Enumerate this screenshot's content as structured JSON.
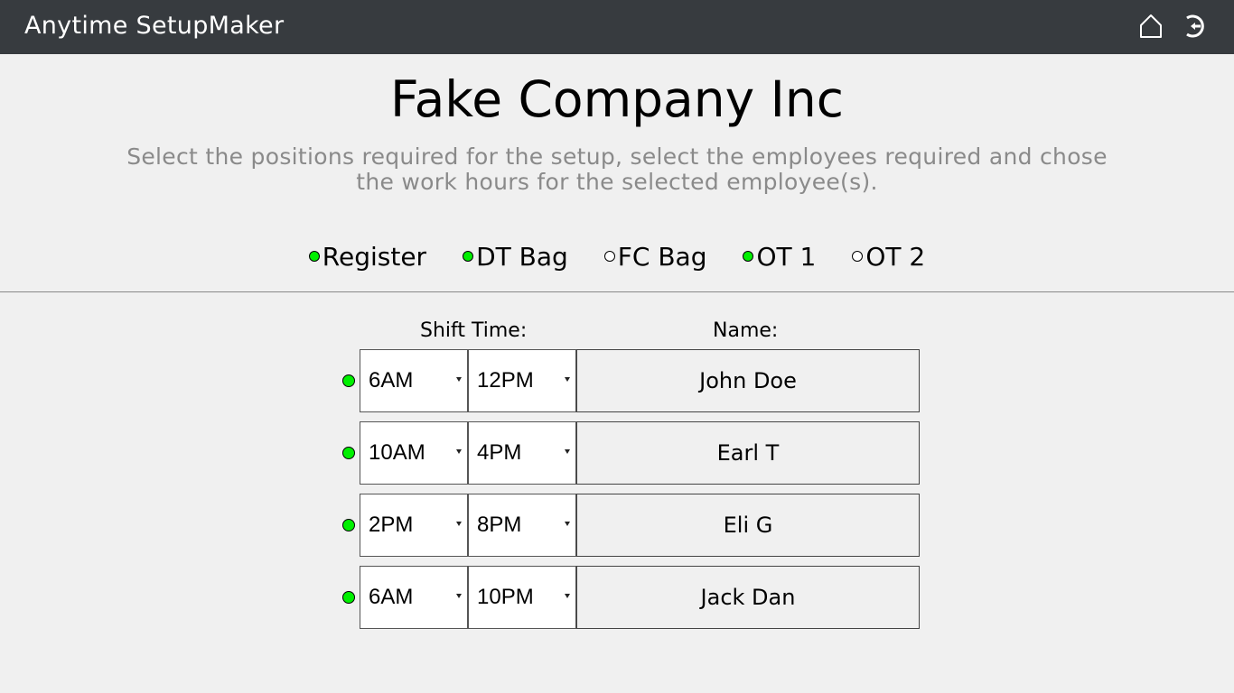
{
  "header": {
    "app_title": "Anytime SetupMaker",
    "icons": [
      "home-icon",
      "logout-icon"
    ],
    "background": "#373b3f"
  },
  "page": {
    "company": "Fake Company Inc",
    "instructions": "Select the positions required for the setup, select the employees required and chose the work hours for the selected employee(s)."
  },
  "positions": [
    {
      "label": "Register",
      "selected": true
    },
    {
      "label": "DT Bag",
      "selected": true
    },
    {
      "label": "FC Bag",
      "selected": false
    },
    {
      "label": "OT 1",
      "selected": true
    },
    {
      "label": "OT 2",
      "selected": false
    }
  ],
  "schedule": {
    "shift_header": "Shift Time:",
    "name_header": "Name:",
    "rows": [
      {
        "start": "6AM",
        "end": "12PM",
        "name": "John Doe",
        "active": true
      },
      {
        "start": "10AM",
        "end": "4PM",
        "name": "Earl T",
        "active": true
      },
      {
        "start": "2PM",
        "end": "8PM",
        "name": "Eli G",
        "active": true
      },
      {
        "start": "6AM",
        "end": "10PM",
        "name": "Jack Dan",
        "active": true
      }
    ]
  },
  "colors": {
    "active_dot": "#00f000",
    "inactive_dot": "#ffffff",
    "page_background": "#f0f0f0"
  }
}
